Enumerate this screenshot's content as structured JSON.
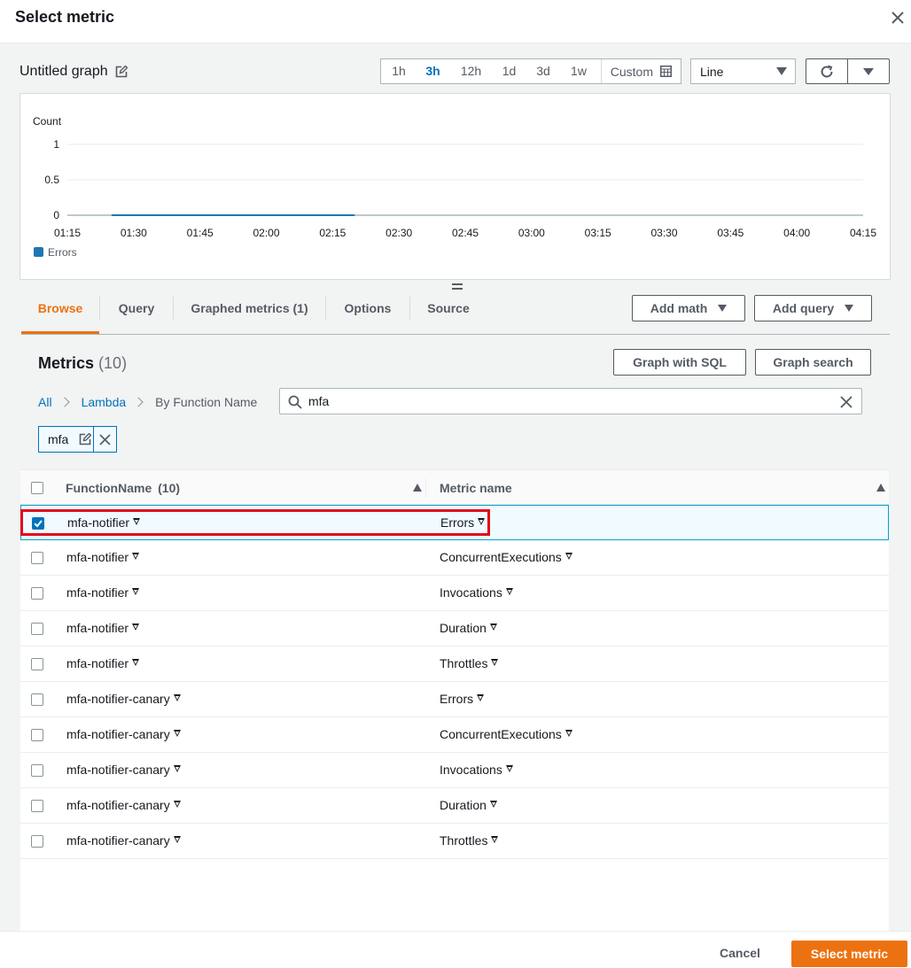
{
  "dialog": {
    "title": "Select metric"
  },
  "graph": {
    "title": "Untitled graph"
  },
  "time_ranges": [
    "1h",
    "3h",
    "12h",
    "1d",
    "3d",
    "1w"
  ],
  "time_range_selected": "3h",
  "custom_label": "Custom",
  "chart_type": "Line",
  "chart_data": {
    "type": "line",
    "ylabel": "Count",
    "ylim": [
      0,
      1
    ],
    "yticks": [
      "1",
      "0.5",
      "0"
    ],
    "xticks": [
      "01:15",
      "01:30",
      "01:45",
      "02:00",
      "02:15",
      "02:30",
      "02:45",
      "03:00",
      "03:15",
      "03:30",
      "03:45",
      "04:00",
      "04:15"
    ],
    "series": [
      {
        "name": "Errors",
        "color": "#1f77b4",
        "x": [
          "01:25",
          "02:20"
        ],
        "values": [
          0,
          0
        ]
      }
    ],
    "legend": "bottom-left"
  },
  "tabs": [
    "Browse",
    "Query",
    "Graphed metrics (1)",
    "Options",
    "Source"
  ],
  "active_tab": "Browse",
  "actions": {
    "add_math": "Add math",
    "add_query": "Add query"
  },
  "metrics": {
    "title": "Metrics",
    "count": "(10)",
    "graph_sql": "Graph with SQL",
    "graph_search": "Graph search",
    "breadcrumb": {
      "all": "All",
      "lambda": "Lambda",
      "current": "By Function Name"
    },
    "search_value": "mfa",
    "token": "mfa"
  },
  "table": {
    "columns": {
      "function": "FunctionName",
      "function_count": "(10)",
      "metric": "Metric name"
    },
    "rows": [
      {
        "function": "mfa-notifier",
        "metric": "Errors",
        "checked": true
      },
      {
        "function": "mfa-notifier",
        "metric": "ConcurrentExecutions",
        "checked": false
      },
      {
        "function": "mfa-notifier",
        "metric": "Invocations",
        "checked": false
      },
      {
        "function": "mfa-notifier",
        "metric": "Duration",
        "checked": false
      },
      {
        "function": "mfa-notifier",
        "metric": "Throttles",
        "checked": false
      },
      {
        "function": "mfa-notifier-canary",
        "metric": "Errors",
        "checked": false
      },
      {
        "function": "mfa-notifier-canary",
        "metric": "ConcurrentExecutions",
        "checked": false
      },
      {
        "function": "mfa-notifier-canary",
        "metric": "Invocations",
        "checked": false
      },
      {
        "function": "mfa-notifier-canary",
        "metric": "Duration",
        "checked": false
      },
      {
        "function": "mfa-notifier-canary",
        "metric": "Throttles",
        "checked": false
      }
    ]
  },
  "footer": {
    "cancel": "Cancel",
    "confirm": "Select metric"
  },
  "colors": {
    "accent": "#ec7211",
    "link": "#0073bb",
    "highlight": "#e0091b"
  }
}
